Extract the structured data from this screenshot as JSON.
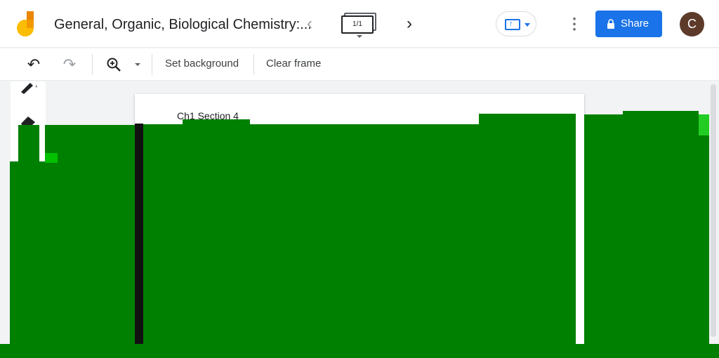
{
  "header": {
    "title": "General, Organic, Biological Chemistry:...",
    "frame_counter": "1/1",
    "share_label": "Share",
    "avatar_initial": "C"
  },
  "toolbar": {
    "set_background_label": "Set background",
    "clear_frame_label": "Clear frame"
  },
  "canvas": {
    "frame_text": "Ch1 Section 4"
  },
  "colors": {
    "accent": "#1a73e8",
    "occlusion": "#008000"
  },
  "icons": [
    "jamboard-logo",
    "chevron-left-icon",
    "frames-icon",
    "chevron-right-icon",
    "cast-screen-icon",
    "more-vert-icon",
    "lock-icon",
    "undo-icon",
    "redo-icon",
    "zoom-in-icon",
    "pen-icon",
    "eraser-icon"
  ]
}
